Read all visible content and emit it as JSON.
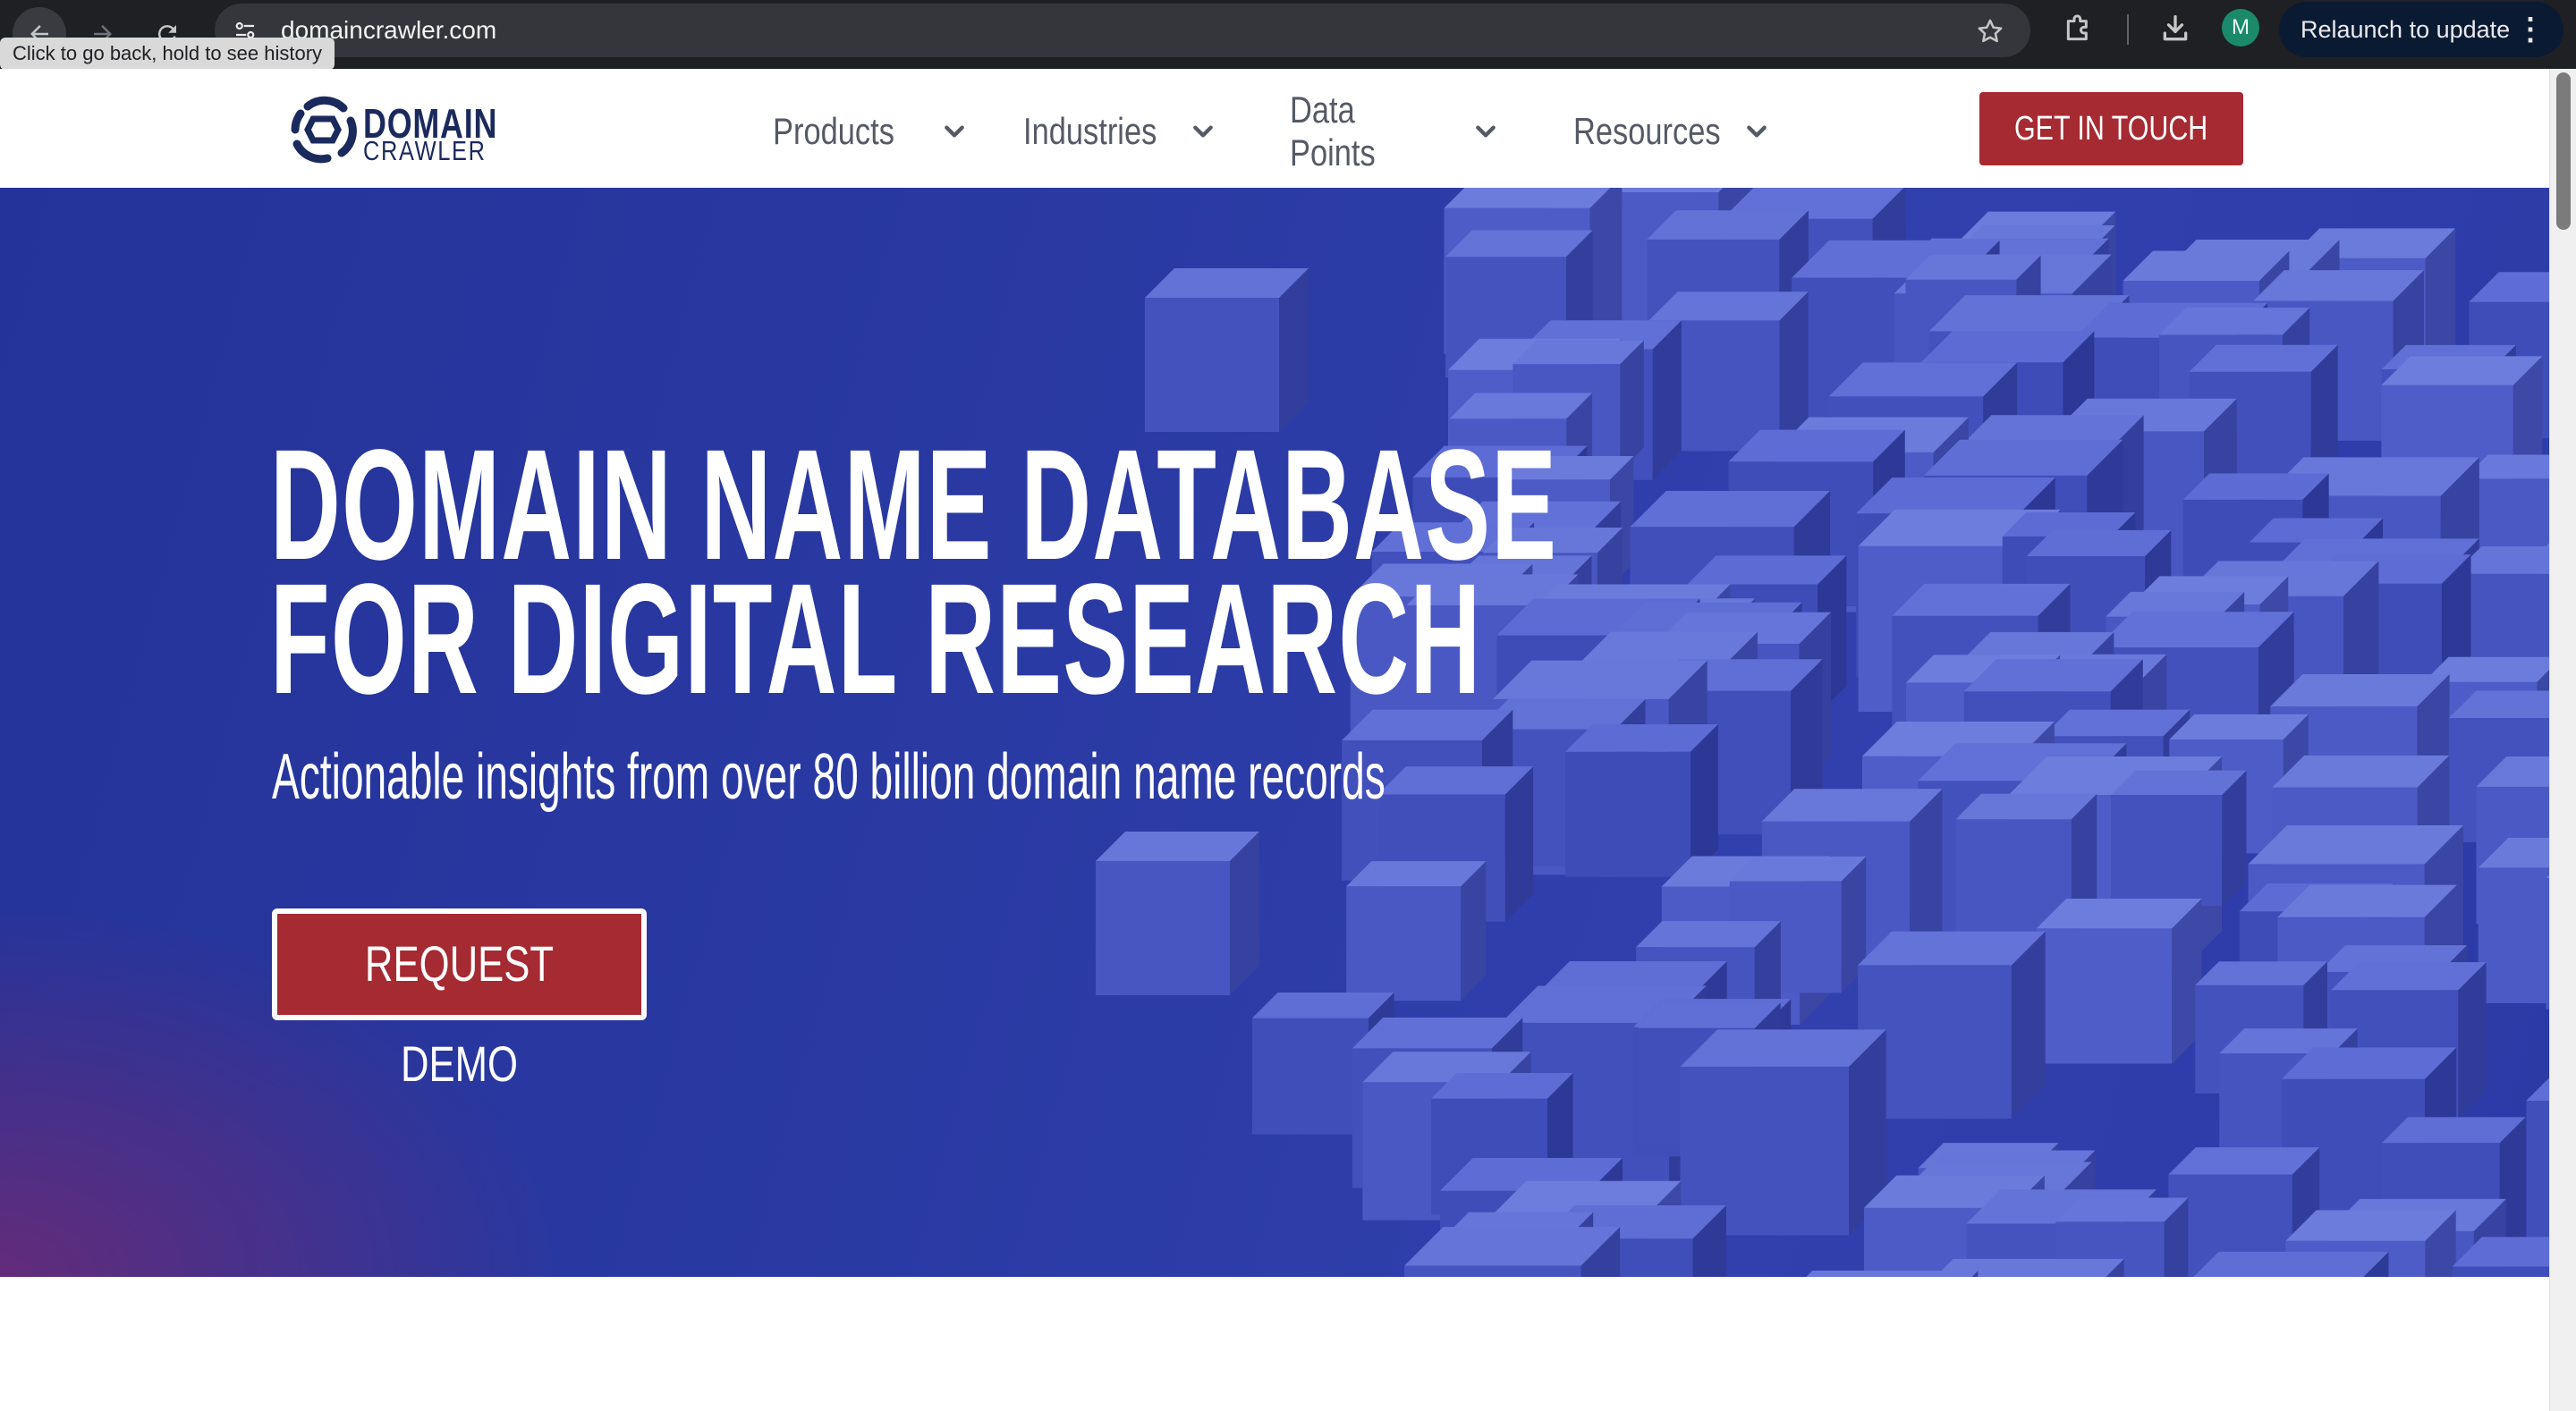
{
  "browser": {
    "url": "domaincrawler.com",
    "tooltip": "Click to go back, hold to see history",
    "profile_initial": "M",
    "relaunch_label": "Relaunch to update",
    "icons": [
      "back-arrow-icon",
      "forward-arrow-icon",
      "reload-icon",
      "site-info-icon",
      "star-icon",
      "extensions-icon",
      "download-icon",
      "more-vert-icon"
    ]
  },
  "header": {
    "logo_line1": "DOMAIN",
    "logo_line2": "CRAWLER",
    "menu": [
      {
        "label": "Products"
      },
      {
        "label": "Industries"
      },
      {
        "label": "Data Points"
      },
      {
        "label": "Resources"
      }
    ],
    "cta_label": "GET IN TOUCH"
  },
  "hero": {
    "title_line1": "DOMAIN NAME DATABASE",
    "title_line2": "FOR DIGITAL RESEARCH",
    "subtitle": "Actionable insights from over 80 billion domain name records",
    "cta_label": "REQUEST DEMO"
  },
  "colors": {
    "brand_navy": "#1b2a5c",
    "accent_red": "#a62a31",
    "hero_blue": "#2a3aa3",
    "chrome_dark": "#1f2024"
  }
}
